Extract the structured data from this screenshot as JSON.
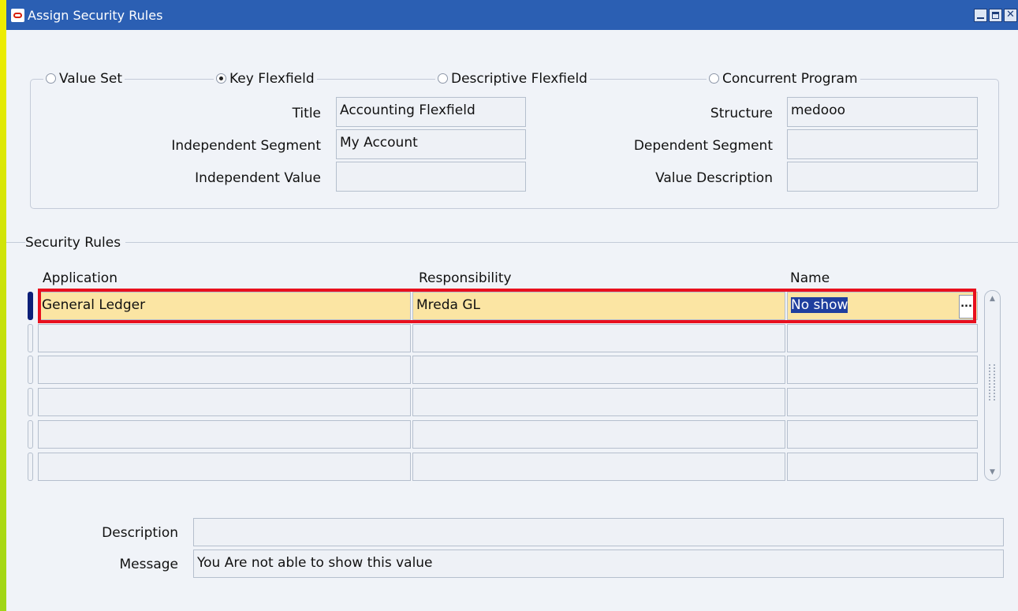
{
  "window": {
    "title": "Assign Security Rules",
    "controls": {
      "minimize_icon": "minimize-icon",
      "maximize_icon": "maximize-icon",
      "close_icon": "close-icon"
    }
  },
  "radio_group": {
    "options": [
      {
        "label": "Value Set",
        "selected": false
      },
      {
        "label": "Key Flexfield",
        "selected": true
      },
      {
        "label": "Descriptive Flexfield",
        "selected": false
      },
      {
        "label": "Concurrent Program",
        "selected": false
      }
    ]
  },
  "form": {
    "title_label": "Title",
    "title_value": "Accounting Flexfield",
    "independent_segment_label": "Independent Segment",
    "independent_segment_value": "My Account",
    "independent_value_label": "Independent Value",
    "independent_value_value": "",
    "structure_label": "Structure",
    "structure_value": "medooo",
    "dependent_segment_label": "Dependent Segment",
    "dependent_segment_value": "",
    "value_description_label": "Value Description",
    "value_description_value": ""
  },
  "security_rules": {
    "section_label": "Security Rules",
    "columns": [
      "Application",
      "Responsibility",
      "Name"
    ],
    "rows": [
      {
        "application": "General Ledger",
        "responsibility": "Mreda GL",
        "name": "No show"
      },
      {
        "application": "",
        "responsibility": "",
        "name": ""
      },
      {
        "application": "",
        "responsibility": "",
        "name": ""
      },
      {
        "application": "",
        "responsibility": "",
        "name": ""
      },
      {
        "application": "",
        "responsibility": "",
        "name": ""
      },
      {
        "application": "",
        "responsibility": "",
        "name": ""
      }
    ],
    "lov_button_label": "...",
    "highlight_color": "#e8101e",
    "current_row_color": "#fbe5a3"
  },
  "footer": {
    "description_label": "Description",
    "description_value": "",
    "message_label": "Message",
    "message_value": "You Are not able to show this value"
  },
  "colors": {
    "titlebar": "#2b5fb3",
    "window_background": "#f0f3f8",
    "desktop_gradient": [
      "#f2ee00",
      "#2fae1c"
    ]
  }
}
